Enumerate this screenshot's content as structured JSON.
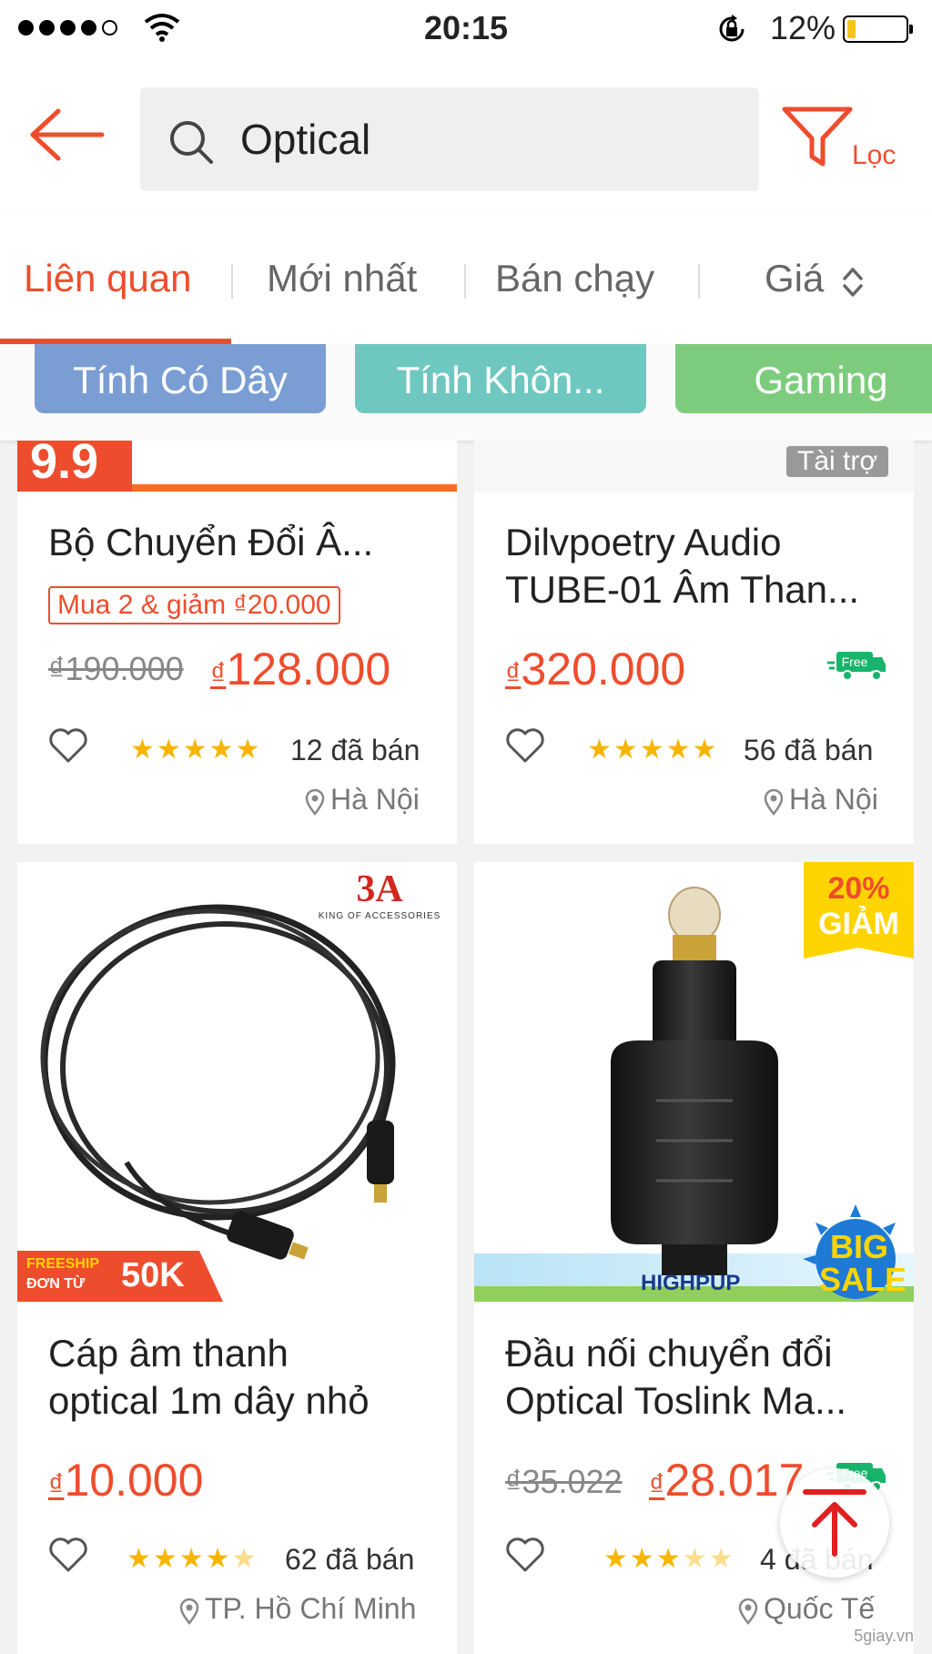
{
  "status": {
    "time": "20:15",
    "battery": "12%"
  },
  "search": {
    "query": "Optical",
    "filter_label": "Lọc"
  },
  "sort_tabs": [
    "Liên quan",
    "Mới nhất",
    "Bán chạy",
    "Giá"
  ],
  "active_tab": "Liên quan",
  "categories": [
    {
      "label": "Tính Có Dây",
      "color": "#7a9ed4"
    },
    {
      "label": "Tính Khôn...",
      "color": "#6fc8c0"
    },
    {
      "label": "Gaming",
      "color": "#7dcc7d"
    }
  ],
  "products": [
    {
      "title": [
        "Bộ Chuyển Đổi Â..."
      ],
      "promo": "Mua 2 & giảm ₫20.000",
      "old_price": "₫190.000",
      "price": "128.000",
      "rating": 5,
      "sold": "12 đã bán",
      "location": "Hà Nội",
      "image_badge": "9.9"
    },
    {
      "title": [
        "Dilvpoetry Audio",
        "TUBE-01 Âm Than..."
      ],
      "price": "320.000",
      "sponsored": "Tài trợ",
      "free_ship": "Free",
      "rating": 5,
      "sold": "56 đã bán",
      "location": "Hà Nội"
    },
    {
      "title": [
        "Cáp âm thanh",
        "optical 1m dây nhỏ"
      ],
      "price": "10.000",
      "rating": 4.5,
      "sold": "62 đã bán",
      "location": "TP. Hồ Chí Minh",
      "image_logo": "3A",
      "image_logo_sub": "KING OF ACCESSORIES",
      "freeship_badge": {
        "line1": "FREESHIP",
        "line2": "ĐƠN TỪ",
        "amount": "50K"
      }
    },
    {
      "title": [
        "Đầu nối chuyển đổi",
        "Optical Toslink Ma..."
      ],
      "old_price": "₫35.022",
      "price": "28.017",
      "free_ship": "Free",
      "rating": 3.5,
      "sold": "4 đã bán",
      "location": "Quốc Tế",
      "discount_badge": {
        "pct": "20%",
        "label": "GIẢM"
      },
      "image_caption": "HIGHPUP",
      "sale_badge": {
        "line1": "BIG",
        "line2": "SALE"
      }
    }
  ],
  "currency_symbol": "₫",
  "watermark": "5giay.vn"
}
